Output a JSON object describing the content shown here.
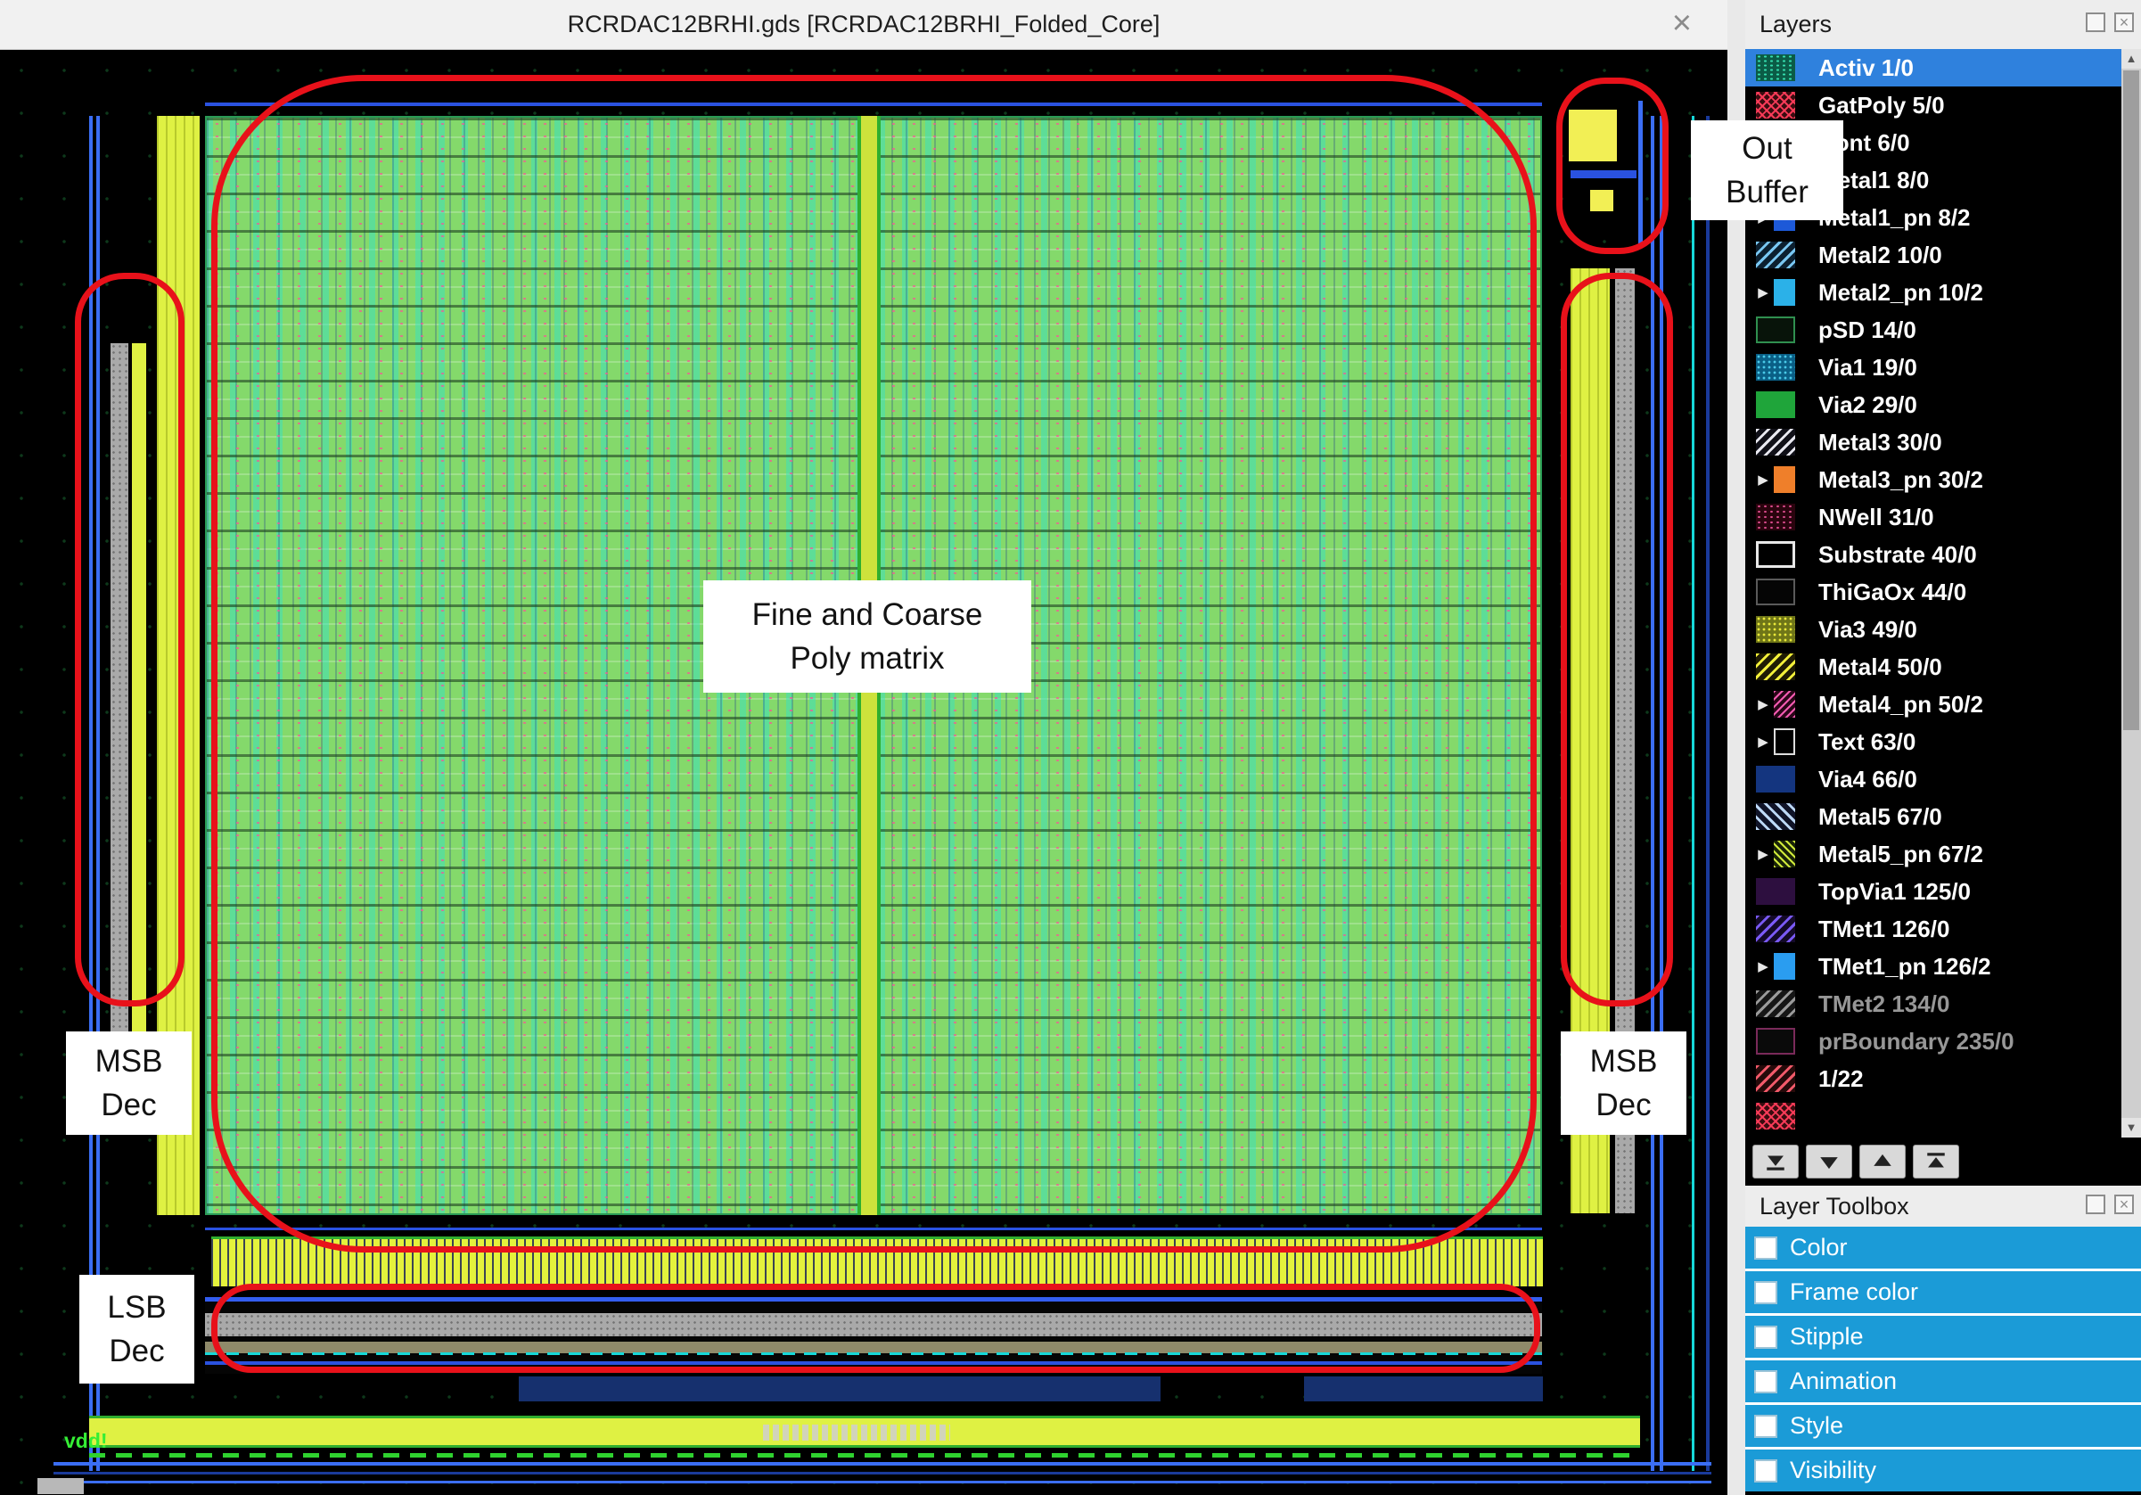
{
  "window": {
    "title": "RCRDAC12BRHI.gds [RCRDAC12BRHI_Folded_Core]",
    "close_glyph": "×"
  },
  "canvas": {
    "vdd_label": "vdd!"
  },
  "annotations": {
    "out_buffer": {
      "line1": "Out",
      "line2": "Buffer"
    },
    "poly_matrix": {
      "line1": "Fine and Coarse",
      "line2": "Poly matrix"
    },
    "msb_left": {
      "line1": "MSB",
      "line2": "Dec"
    },
    "msb_right": {
      "line1": "MSB",
      "line2": "Dec"
    },
    "lsb": {
      "line1": "LSB",
      "line2": "Dec"
    }
  },
  "layers_panel": {
    "title": "Layers",
    "scroll_up_glyph": "▲",
    "scroll_down_glyph": "▼",
    "expand_glyph": "▶",
    "items": [
      {
        "label": "Activ 1/0",
        "selected": true
      },
      {
        "label": "GatPoly 5/0"
      },
      {
        "label": "Cont 6/0"
      },
      {
        "label": "Metal1 8/0"
      },
      {
        "label": "Metal1_pn 8/2"
      },
      {
        "label": "Metal2 10/0"
      },
      {
        "label": "Metal2_pn 10/2"
      },
      {
        "label": "pSD 14/0"
      },
      {
        "label": "Via1 19/0"
      },
      {
        "label": "Via2 29/0"
      },
      {
        "label": "Metal3 30/0"
      },
      {
        "label": "Metal3_pn 30/2"
      },
      {
        "label": "NWell 31/0"
      },
      {
        "label": "Substrate 40/0"
      },
      {
        "label": "ThiGaOx 44/0"
      },
      {
        "label": "Via3 49/0"
      },
      {
        "label": "Metal4 50/0"
      },
      {
        "label": "Metal4_pn 50/2"
      },
      {
        "label": "Text 63/0"
      },
      {
        "label": "Via4 66/0"
      },
      {
        "label": "Metal5 67/0"
      },
      {
        "label": "Metal5_pn 67/2"
      },
      {
        "label": "TopVia1 125/0"
      },
      {
        "label": "TMet1 126/0"
      },
      {
        "label": "TMet1_pn 126/2"
      },
      {
        "label": "TMet2 134/0",
        "dimmed": true
      },
      {
        "label": "prBoundary 235/0",
        "dimmed": true
      },
      {
        "label": "1/22"
      }
    ],
    "buttons": [
      "move-to-bottom-icon",
      "move-down-icon",
      "move-up-icon",
      "move-to-top-icon"
    ]
  },
  "toolbox": {
    "title": "Layer Toolbox",
    "rows": [
      "Color",
      "Frame color",
      "Stipple",
      "Animation",
      "Style",
      "Visibility"
    ]
  }
}
